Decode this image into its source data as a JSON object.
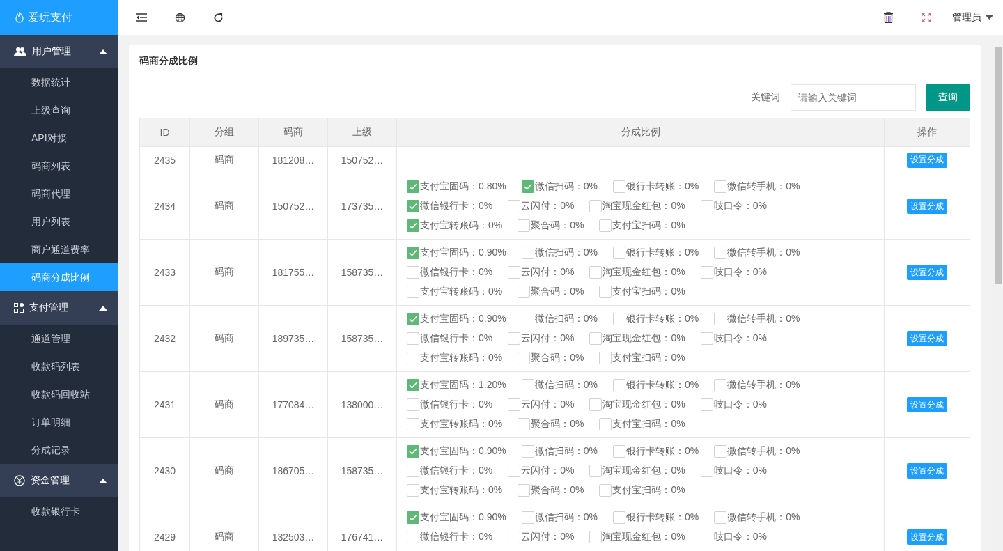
{
  "brand": {
    "name": "爱玩支付"
  },
  "sidebar": {
    "groups": [
      {
        "title": "用户管理",
        "expanded": true,
        "items": [
          {
            "label": "数据统计",
            "selected": false
          },
          {
            "label": "上级查询",
            "selected": false
          },
          {
            "label": "API对接",
            "selected": false
          },
          {
            "label": "码商列表",
            "selected": false
          },
          {
            "label": "码商代理",
            "selected": false
          },
          {
            "label": "用户列表",
            "selected": false
          },
          {
            "label": "商户通道费率",
            "selected": false
          },
          {
            "label": "码商分成比例",
            "selected": true
          }
        ]
      },
      {
        "title": "支付管理",
        "expanded": true,
        "items": [
          {
            "label": "通道管理",
            "selected": false
          },
          {
            "label": "收款码列表",
            "selected": false
          },
          {
            "label": "收款码回收站",
            "selected": false
          },
          {
            "label": "订单明细",
            "selected": false
          },
          {
            "label": "分成记录",
            "selected": false
          }
        ]
      },
      {
        "title": "资金管理",
        "expanded": true,
        "items": [
          {
            "label": "收款银行卡",
            "selected": false
          }
        ]
      }
    ]
  },
  "topbar": {
    "user": "管理员"
  },
  "card": {
    "title": "码商分成比例",
    "search_label": "关键词",
    "search": {
      "placeholder": "请输入关键词"
    },
    "search_button": "查询"
  },
  "table": {
    "columns": [
      "ID",
      "分组",
      "码商",
      "上级",
      "分成比例",
      "操作"
    ],
    "rows": [
      {
        "id": "2435",
        "group": "码商",
        "merchant": "181208…",
        "parent": "150752…",
        "lines": [],
        "action": "设置分成"
      },
      {
        "id": "2434",
        "group": "码商",
        "merchant": "150752…",
        "parent": "173735…",
        "lines": [
          [
            {
              "label": "支付宝固码：0.80%",
              "checked": true
            },
            {
              "label": "微信扫码：0%",
              "checked": true
            },
            {
              "label": "银行卡转账：0%",
              "checked": false
            },
            {
              "label": "微信转手机：0%",
              "checked": false
            }
          ],
          [
            {
              "label": "微信银行卡：0%",
              "checked": true
            },
            {
              "label": "云闪付：0%",
              "checked": false
            },
            {
              "label": "淘宝现金红包：0%",
              "checked": false
            },
            {
              "label": "吱口令：0%",
              "checked": false
            }
          ],
          [
            {
              "label": "支付宝转账码：0%",
              "checked": true
            },
            {
              "label": "聚合码：0%",
              "checked": false
            },
            {
              "label": "支付宝扫码：0%",
              "checked": false
            }
          ]
        ],
        "action": "设置分成"
      },
      {
        "id": "2433",
        "group": "码商",
        "merchant": "181755…",
        "parent": "158735…",
        "lines": [
          [
            {
              "label": "支付宝固码：0.90%",
              "checked": true
            },
            {
              "label": "微信扫码：0%",
              "checked": false
            },
            {
              "label": "银行卡转账：0%",
              "checked": false
            },
            {
              "label": "微信转手机：0%",
              "checked": false
            }
          ],
          [
            {
              "label": "微信银行卡：0%",
              "checked": false
            },
            {
              "label": "云闪付：0%",
              "checked": false
            },
            {
              "label": "淘宝现金红包：0%",
              "checked": false
            },
            {
              "label": "吱口令：0%",
              "checked": false
            }
          ],
          [
            {
              "label": "支付宝转账码：0%",
              "checked": false
            },
            {
              "label": "聚合码：0%",
              "checked": false
            },
            {
              "label": "支付宝扫码：0%",
              "checked": false
            }
          ]
        ],
        "action": "设置分成"
      },
      {
        "id": "2432",
        "group": "码商",
        "merchant": "189735…",
        "parent": "158735…",
        "lines": [
          [
            {
              "label": "支付宝固码：0.90%",
              "checked": true
            },
            {
              "label": "微信扫码：0%",
              "checked": false
            },
            {
              "label": "银行卡转账：0%",
              "checked": false
            },
            {
              "label": "微信转手机：0%",
              "checked": false
            }
          ],
          [
            {
              "label": "微信银行卡：0%",
              "checked": false
            },
            {
              "label": "云闪付：0%",
              "checked": false
            },
            {
              "label": "淘宝现金红包：0%",
              "checked": false
            },
            {
              "label": "吱口令：0%",
              "checked": false
            }
          ],
          [
            {
              "label": "支付宝转账码：0%",
              "checked": false
            },
            {
              "label": "聚合码：0%",
              "checked": false
            },
            {
              "label": "支付宝扫码：0%",
              "checked": false
            }
          ]
        ],
        "action": "设置分成"
      },
      {
        "id": "2431",
        "group": "码商",
        "merchant": "177084…",
        "parent": "138000…",
        "lines": [
          [
            {
              "label": "支付宝固码：1.20%",
              "checked": true
            },
            {
              "label": "微信扫码：0%",
              "checked": false
            },
            {
              "label": "银行卡转账：0%",
              "checked": false
            },
            {
              "label": "微信转手机：0%",
              "checked": false
            }
          ],
          [
            {
              "label": "微信银行卡：0%",
              "checked": false
            },
            {
              "label": "云闪付：0%",
              "checked": false
            },
            {
              "label": "淘宝现金红包：0%",
              "checked": false
            },
            {
              "label": "吱口令：0%",
              "checked": false
            }
          ],
          [
            {
              "label": "支付宝转账码：0%",
              "checked": false
            },
            {
              "label": "聚合码：0%",
              "checked": false
            },
            {
              "label": "支付宝扫码：0%",
              "checked": false
            }
          ]
        ],
        "action": "设置分成"
      },
      {
        "id": "2430",
        "group": "码商",
        "merchant": "186705…",
        "parent": "158735…",
        "lines": [
          [
            {
              "label": "支付宝固码：0.90%",
              "checked": true
            },
            {
              "label": "微信扫码：0%",
              "checked": false
            },
            {
              "label": "银行卡转账：0%",
              "checked": false
            },
            {
              "label": "微信转手机：0%",
              "checked": false
            }
          ],
          [
            {
              "label": "微信银行卡：0%",
              "checked": false
            },
            {
              "label": "云闪付：0%",
              "checked": false
            },
            {
              "label": "淘宝现金红包：0%",
              "checked": false
            },
            {
              "label": "吱口令：0%",
              "checked": false
            }
          ],
          [
            {
              "label": "支付宝转账码：0%",
              "checked": false
            },
            {
              "label": "聚合码：0%",
              "checked": false
            },
            {
              "label": "支付宝扫码：0%",
              "checked": false
            }
          ]
        ],
        "action": "设置分成"
      },
      {
        "id": "2429",
        "group": "码商",
        "merchant": "132503…",
        "parent": "176741…",
        "lines": [
          [
            {
              "label": "支付宝固码：0.90%",
              "checked": true
            },
            {
              "label": "微信扫码：0%",
              "checked": false
            },
            {
              "label": "银行卡转账：0%",
              "checked": false
            },
            {
              "label": "微信转手机：0%",
              "checked": false
            }
          ],
          [
            {
              "label": "微信银行卡：0%",
              "checked": false
            },
            {
              "label": "云闪付：0%",
              "checked": false
            },
            {
              "label": "淘宝现金红包：0%",
              "checked": false
            },
            {
              "label": "吱口令：0%",
              "checked": false
            }
          ]
        ],
        "action": "设置分成"
      }
    ]
  }
}
